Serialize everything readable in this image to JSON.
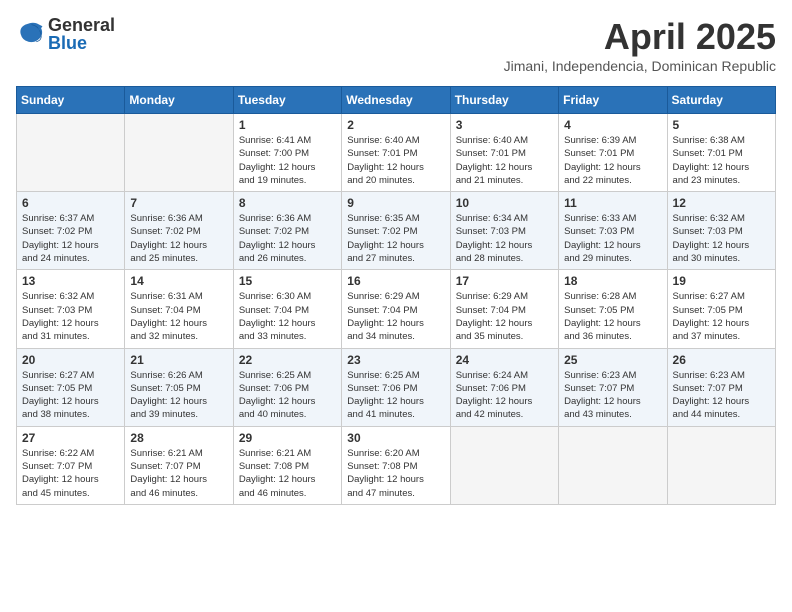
{
  "header": {
    "logo": {
      "general": "General",
      "blue": "Blue"
    },
    "title": "April 2025",
    "subtitle": "Jimani, Independencia, Dominican Republic"
  },
  "weekdays": [
    "Sunday",
    "Monday",
    "Tuesday",
    "Wednesday",
    "Thursday",
    "Friday",
    "Saturday"
  ],
  "weeks": [
    [
      {
        "day": "",
        "info": ""
      },
      {
        "day": "",
        "info": ""
      },
      {
        "day": "1",
        "info": "Sunrise: 6:41 AM\nSunset: 7:00 PM\nDaylight: 12 hours\nand 19 minutes."
      },
      {
        "day": "2",
        "info": "Sunrise: 6:40 AM\nSunset: 7:01 PM\nDaylight: 12 hours\nand 20 minutes."
      },
      {
        "day": "3",
        "info": "Sunrise: 6:40 AM\nSunset: 7:01 PM\nDaylight: 12 hours\nand 21 minutes."
      },
      {
        "day": "4",
        "info": "Sunrise: 6:39 AM\nSunset: 7:01 PM\nDaylight: 12 hours\nand 22 minutes."
      },
      {
        "day": "5",
        "info": "Sunrise: 6:38 AM\nSunset: 7:01 PM\nDaylight: 12 hours\nand 23 minutes."
      }
    ],
    [
      {
        "day": "6",
        "info": "Sunrise: 6:37 AM\nSunset: 7:02 PM\nDaylight: 12 hours\nand 24 minutes."
      },
      {
        "day": "7",
        "info": "Sunrise: 6:36 AM\nSunset: 7:02 PM\nDaylight: 12 hours\nand 25 minutes."
      },
      {
        "day": "8",
        "info": "Sunrise: 6:36 AM\nSunset: 7:02 PM\nDaylight: 12 hours\nand 26 minutes."
      },
      {
        "day": "9",
        "info": "Sunrise: 6:35 AM\nSunset: 7:02 PM\nDaylight: 12 hours\nand 27 minutes."
      },
      {
        "day": "10",
        "info": "Sunrise: 6:34 AM\nSunset: 7:03 PM\nDaylight: 12 hours\nand 28 minutes."
      },
      {
        "day": "11",
        "info": "Sunrise: 6:33 AM\nSunset: 7:03 PM\nDaylight: 12 hours\nand 29 minutes."
      },
      {
        "day": "12",
        "info": "Sunrise: 6:32 AM\nSunset: 7:03 PM\nDaylight: 12 hours\nand 30 minutes."
      }
    ],
    [
      {
        "day": "13",
        "info": "Sunrise: 6:32 AM\nSunset: 7:03 PM\nDaylight: 12 hours\nand 31 minutes."
      },
      {
        "day": "14",
        "info": "Sunrise: 6:31 AM\nSunset: 7:04 PM\nDaylight: 12 hours\nand 32 minutes."
      },
      {
        "day": "15",
        "info": "Sunrise: 6:30 AM\nSunset: 7:04 PM\nDaylight: 12 hours\nand 33 minutes."
      },
      {
        "day": "16",
        "info": "Sunrise: 6:29 AM\nSunset: 7:04 PM\nDaylight: 12 hours\nand 34 minutes."
      },
      {
        "day": "17",
        "info": "Sunrise: 6:29 AM\nSunset: 7:04 PM\nDaylight: 12 hours\nand 35 minutes."
      },
      {
        "day": "18",
        "info": "Sunrise: 6:28 AM\nSunset: 7:05 PM\nDaylight: 12 hours\nand 36 minutes."
      },
      {
        "day": "19",
        "info": "Sunrise: 6:27 AM\nSunset: 7:05 PM\nDaylight: 12 hours\nand 37 minutes."
      }
    ],
    [
      {
        "day": "20",
        "info": "Sunrise: 6:27 AM\nSunset: 7:05 PM\nDaylight: 12 hours\nand 38 minutes."
      },
      {
        "day": "21",
        "info": "Sunrise: 6:26 AM\nSunset: 7:05 PM\nDaylight: 12 hours\nand 39 minutes."
      },
      {
        "day": "22",
        "info": "Sunrise: 6:25 AM\nSunset: 7:06 PM\nDaylight: 12 hours\nand 40 minutes."
      },
      {
        "day": "23",
        "info": "Sunrise: 6:25 AM\nSunset: 7:06 PM\nDaylight: 12 hours\nand 41 minutes."
      },
      {
        "day": "24",
        "info": "Sunrise: 6:24 AM\nSunset: 7:06 PM\nDaylight: 12 hours\nand 42 minutes."
      },
      {
        "day": "25",
        "info": "Sunrise: 6:23 AM\nSunset: 7:07 PM\nDaylight: 12 hours\nand 43 minutes."
      },
      {
        "day": "26",
        "info": "Sunrise: 6:23 AM\nSunset: 7:07 PM\nDaylight: 12 hours\nand 44 minutes."
      }
    ],
    [
      {
        "day": "27",
        "info": "Sunrise: 6:22 AM\nSunset: 7:07 PM\nDaylight: 12 hours\nand 45 minutes."
      },
      {
        "day": "28",
        "info": "Sunrise: 6:21 AM\nSunset: 7:07 PM\nDaylight: 12 hours\nand 46 minutes."
      },
      {
        "day": "29",
        "info": "Sunrise: 6:21 AM\nSunset: 7:08 PM\nDaylight: 12 hours\nand 46 minutes."
      },
      {
        "day": "30",
        "info": "Sunrise: 6:20 AM\nSunset: 7:08 PM\nDaylight: 12 hours\nand 47 minutes."
      },
      {
        "day": "",
        "info": ""
      },
      {
        "day": "",
        "info": ""
      },
      {
        "day": "",
        "info": ""
      }
    ]
  ]
}
